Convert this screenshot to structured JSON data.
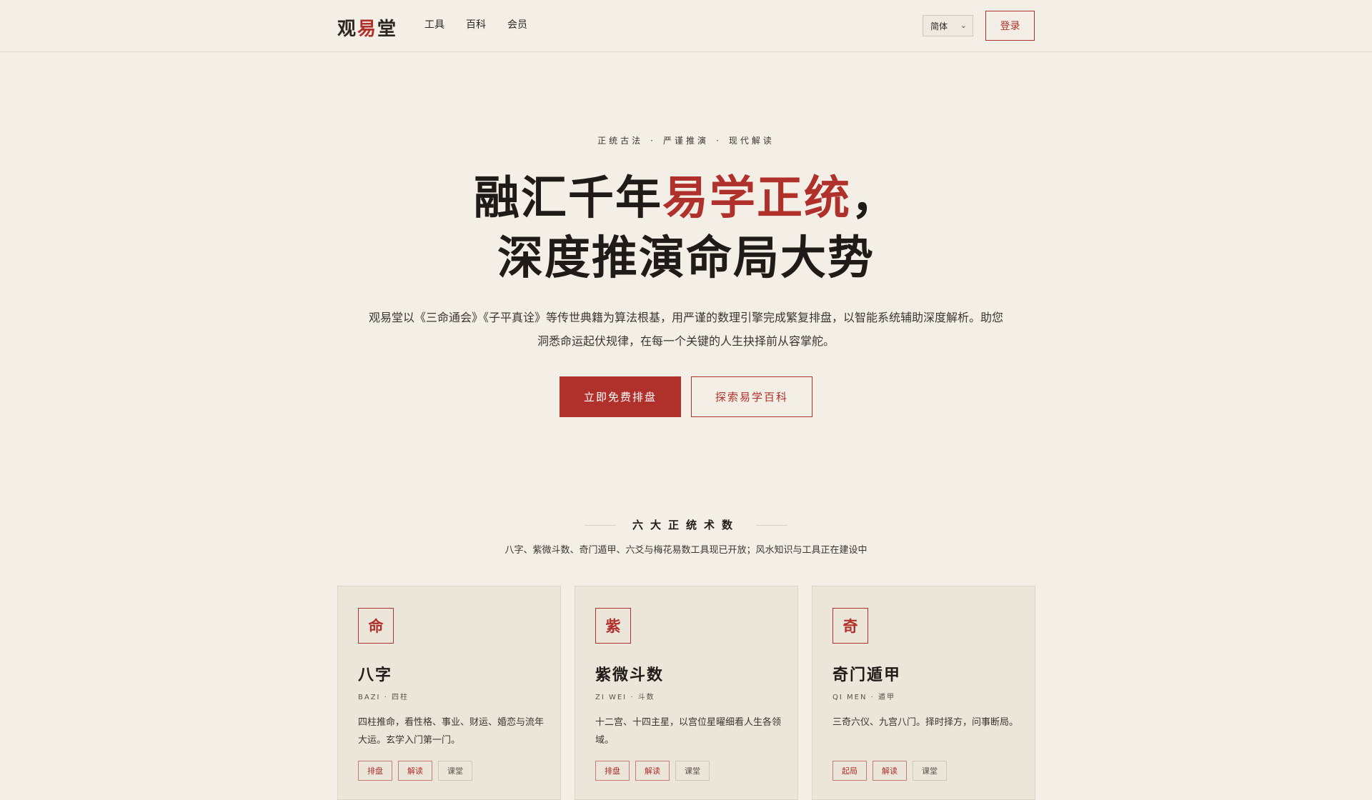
{
  "header": {
    "logo": {
      "left": "观",
      "mid": "易",
      "right": "堂"
    },
    "nav": [
      "工具",
      "百科",
      "会员"
    ],
    "language": "简体",
    "login_label": "登录"
  },
  "hero": {
    "tagline": [
      "正统古法",
      "严谨推演",
      "现代解读"
    ],
    "headline_line1_prefix": "融汇千年",
    "headline_line1_accent": "易学正统",
    "headline_line1_suffix": "，",
    "headline_line2": "深度推演命局大势",
    "intro": "观易堂以《三命通会》《子平真诠》等传世典籍为算法根基，用严谨的数理引擎完成繁复排盘，以智能系统辅助深度解析。助您洞悉命运起伏规律，在每一个关键的人生抉择前从容掌舵。",
    "primary_cta": "立即免费排盘",
    "secondary_cta": "探索易学百科"
  },
  "section": {
    "title": "六大正统术数",
    "subtitle": "八字、紫微斗数、奇门遁甲、六爻与梅花易数工具现已开放；风水知识与工具正在建设中"
  },
  "cards": [
    {
      "seal": "命",
      "name": "八字",
      "sub": "BAZI · 四柱",
      "desc": "四柱推命，看性格、事业、财运、婚恋与流年大运。玄学入门第一门。",
      "tags": [
        "排盘",
        "解读",
        "课堂"
      ]
    },
    {
      "seal": "紫",
      "name": "紫微斗数",
      "sub": "ZI WEI · 斗数",
      "desc": "十二宫、十四主星，以宫位星曜细看人生各领域。",
      "tags": [
        "排盘",
        "解读",
        "课堂"
      ]
    },
    {
      "seal": "奇",
      "name": "奇门遁甲",
      "sub": "QI MEN · 遁甲",
      "desc": "三奇六仪、九宫八门。择时择方，问事断局。",
      "tags": [
        "起局",
        "解读",
        "课堂"
      ]
    }
  ]
}
